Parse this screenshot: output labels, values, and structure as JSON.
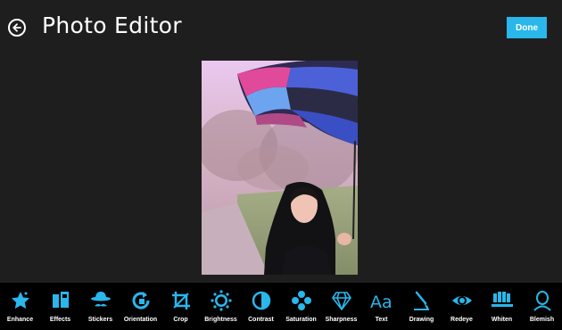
{
  "header": {
    "title": "Photo Editor",
    "done_label": "Done"
  },
  "colors": {
    "accent": "#29b7ec",
    "background": "#1e1e1e",
    "toolbar": "#000000"
  },
  "photo": {
    "subject": "woman-under-umbrella"
  },
  "tools": [
    {
      "label": "Enhance",
      "icon": "star-icon"
    },
    {
      "label": "Effects",
      "icon": "effects-icon"
    },
    {
      "label": "Stickers",
      "icon": "hat-mustache-icon"
    },
    {
      "label": "Orientation",
      "icon": "rotate-icon"
    },
    {
      "label": "Crop",
      "icon": "crop-icon"
    },
    {
      "label": "Brightness",
      "icon": "sun-icon"
    },
    {
      "label": "Contrast",
      "icon": "contrast-icon"
    },
    {
      "label": "Saturation",
      "icon": "saturation-icon"
    },
    {
      "label": "Sharpness",
      "icon": "diamond-icon"
    },
    {
      "label": "Text",
      "icon": "text-aa-icon"
    },
    {
      "label": "Drawing",
      "icon": "brush-icon"
    },
    {
      "label": "Redeye",
      "icon": "eye-icon"
    },
    {
      "label": "Whiten",
      "icon": "teeth-icon"
    },
    {
      "label": "Blemish",
      "icon": "face-icon"
    }
  ]
}
